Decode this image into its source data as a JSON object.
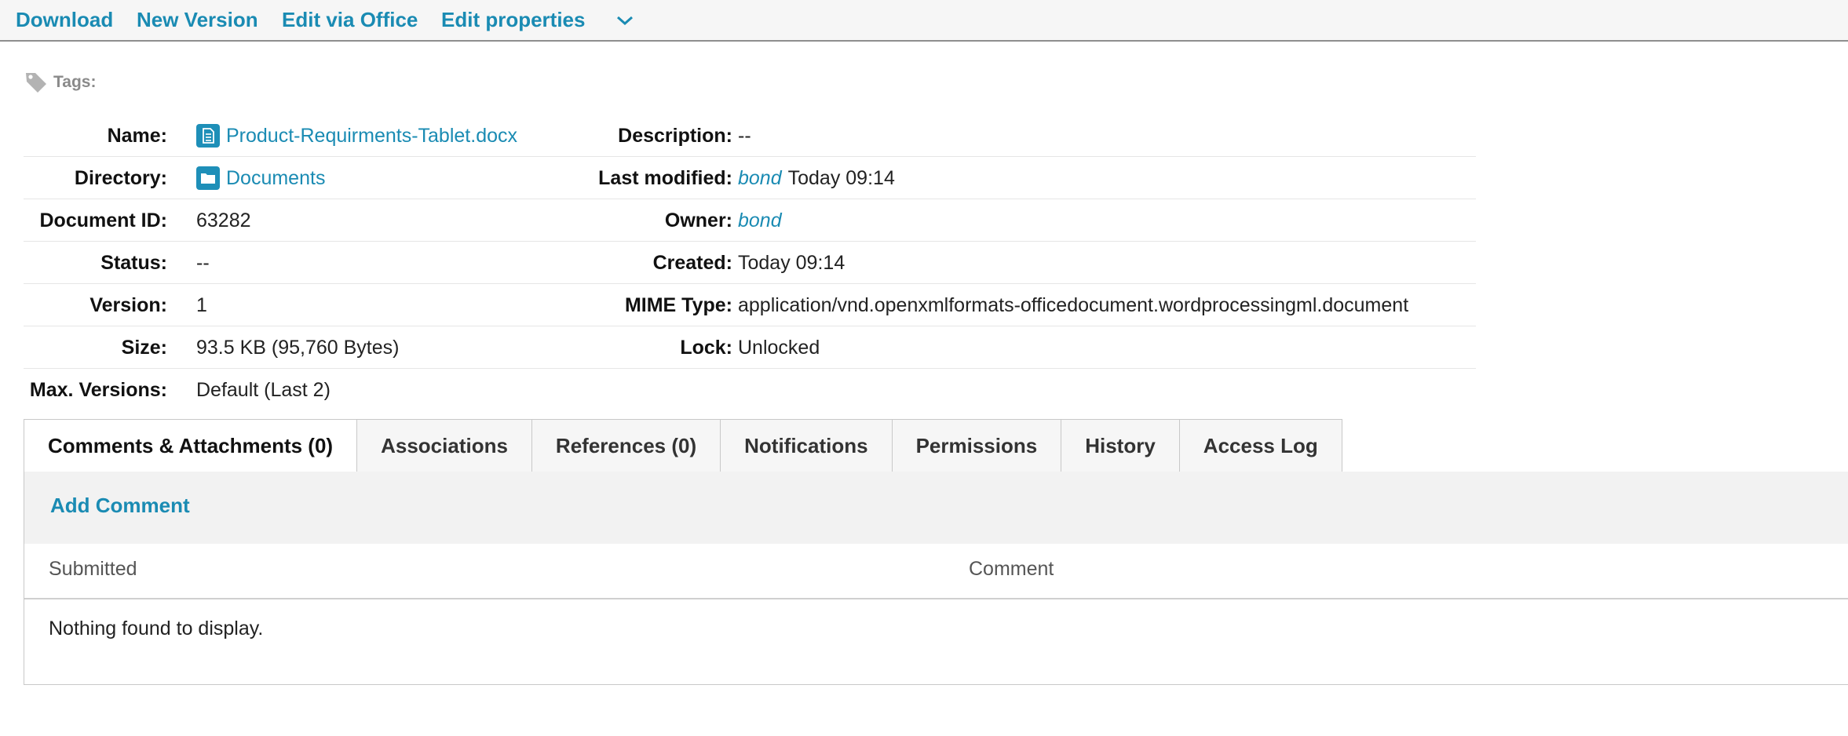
{
  "toolbar": {
    "download": "Download",
    "new_version": "New Version",
    "edit_office": "Edit via Office",
    "edit_properties": "Edit properties",
    "more_icon": "chevron-down-icon"
  },
  "tags": {
    "label": "Tags:",
    "icon": "tag-icon"
  },
  "properties": {
    "name_label": "Name:",
    "name_value": "Product-Requirments-Tablet.docx",
    "description_label": "Description:",
    "description_value": "--",
    "directory_label": "Directory:",
    "directory_value": "Documents",
    "last_modified_label": "Last modified:",
    "last_modified_user": "bond",
    "last_modified_time": "Today 09:14",
    "document_id_label": "Document ID:",
    "document_id_value": "63282",
    "owner_label": "Owner:",
    "owner_value": "bond",
    "status_label": "Status:",
    "status_value": "--",
    "created_label": "Created:",
    "created_value": "Today 09:14",
    "version_label": "Version:",
    "version_value": "1",
    "mime_label": "MIME Type:",
    "mime_value": "application/vnd.openxmlformats-officedocument.wordprocessingml.document",
    "size_label": "Size:",
    "size_value": "93.5 KB (95,760 Bytes)",
    "lock_label": "Lock:",
    "lock_value": "Unlocked",
    "max_versions_label": "Max. Versions:",
    "max_versions_value": "Default (Last 2)"
  },
  "tabs": [
    {
      "label": "Comments & Attachments (0)",
      "active": true
    },
    {
      "label": "Associations"
    },
    {
      "label": "References (0)"
    },
    {
      "label": "Notifications"
    },
    {
      "label": "Permissions"
    },
    {
      "label": "History"
    },
    {
      "label": "Access Log"
    }
  ],
  "comments": {
    "add_label": "Add Comment",
    "col_submitted": "Submitted",
    "col_comment": "Comment",
    "empty_text": "Nothing found to display."
  },
  "colors": {
    "link": "#1a8bb3",
    "icon_blue": "#1e8fb8",
    "toolbar_bg": "#f6f6f6"
  }
}
